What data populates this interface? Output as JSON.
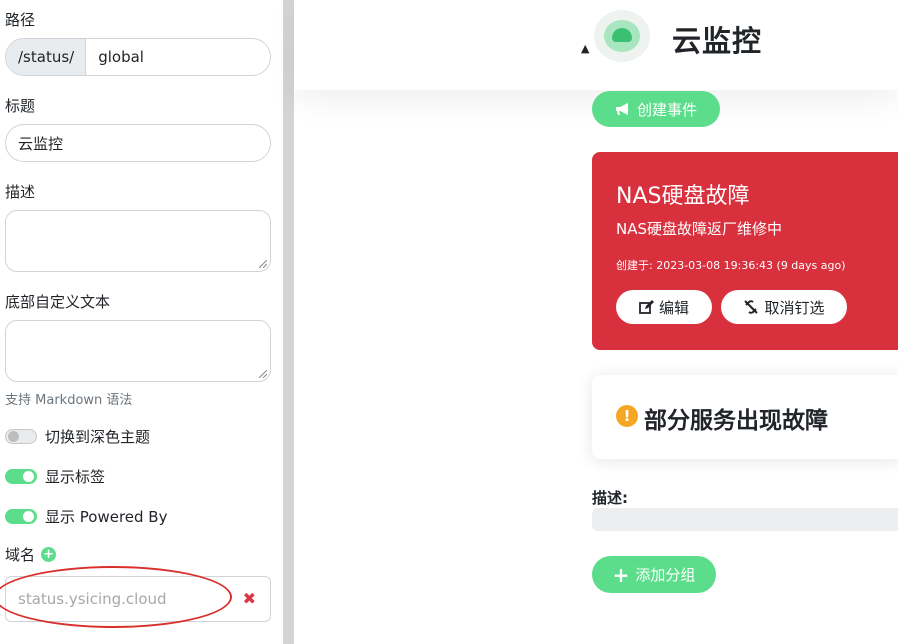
{
  "sidebar": {
    "path_label": "路径",
    "path_prefix": "/status/",
    "path_value": "global",
    "title_label": "标题",
    "title_value": "云监控",
    "description_label": "描述",
    "footer_label": "底部自定义文本",
    "markdown_hint": "支持 Markdown 语法",
    "toggles": [
      {
        "label": "切换到深色主题",
        "on": false
      },
      {
        "label": "显示标签",
        "on": true
      },
      {
        "label": "显示 Powered By",
        "on": true
      }
    ],
    "domain_label": "域名",
    "domain_placeholder": "status.ysicing.cloud",
    "remove_glyph": "✖",
    "cut_text": "..."
  },
  "main": {
    "site_title": "云监控",
    "create_incident_label": "创建事件",
    "incident": {
      "title": "NAS硬盘故障",
      "body": "NAS硬盘故障返厂维修中",
      "created": "创建于: 2023-03-08 19:36:43 (9 days ago)",
      "edit_label": "编辑",
      "unpin_label": "取消钉选"
    },
    "status_text": "部分服务出现故障",
    "description_label": "描述:",
    "add_group_label": "添加分组"
  },
  "colors": {
    "accent_green": "#5cdd8b",
    "danger_red": "#d9303e",
    "warning_orange": "#f5a623",
    "annotation_red": "#d9302c"
  }
}
